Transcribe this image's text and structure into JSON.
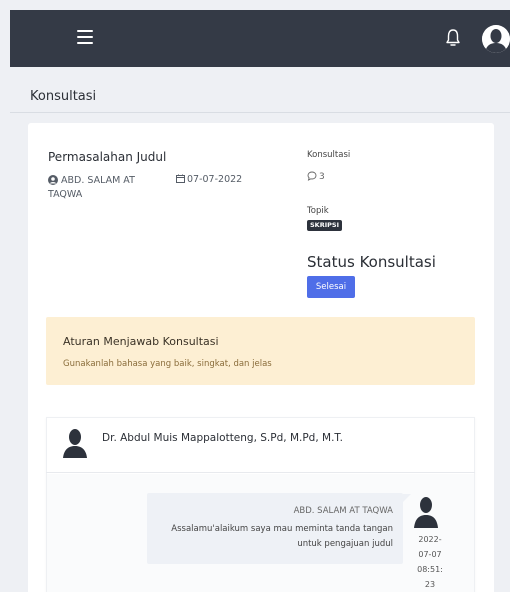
{
  "header": {
    "menu_icon": "hamburger-menu-icon",
    "notification_icon": "bell-icon",
    "avatar_icon": "user-avatar-icon"
  },
  "page": {
    "title": "Konsultasi"
  },
  "consultation": {
    "title": "Permasalahan Judul",
    "author": "ABD. SALAM AT TAQWA",
    "date": "07-07-2022",
    "consultation_label": "Konsultasi",
    "consultation_count": "3",
    "topic_label": "Topik",
    "topic_badge": "SKRIPSI",
    "status_title": "Status Konsultasi",
    "status_value": "Selesai"
  },
  "rules": {
    "title": "Aturan Menjawab Konsultasi",
    "text": "Gunakanlah bahasa yang baik, singkat, dan jelas"
  },
  "conversation": {
    "advisor_name": "Dr. Abdul Muis Mappalotteng, S.Pd, M.Pd, M.T.",
    "messages": [
      {
        "sender": "ABD. SALAM AT TAQWA",
        "text": "Assalamu'alaikum saya mau meminta tanda tangan untuk pengajuan judul",
        "timestamp": "2022-07-07 08:51:23"
      }
    ]
  },
  "colors": {
    "topbar": "#343a46",
    "primary_button": "#4f6ee8",
    "alert_background": "#fdefd3",
    "badge_dark": "#2d323c"
  }
}
